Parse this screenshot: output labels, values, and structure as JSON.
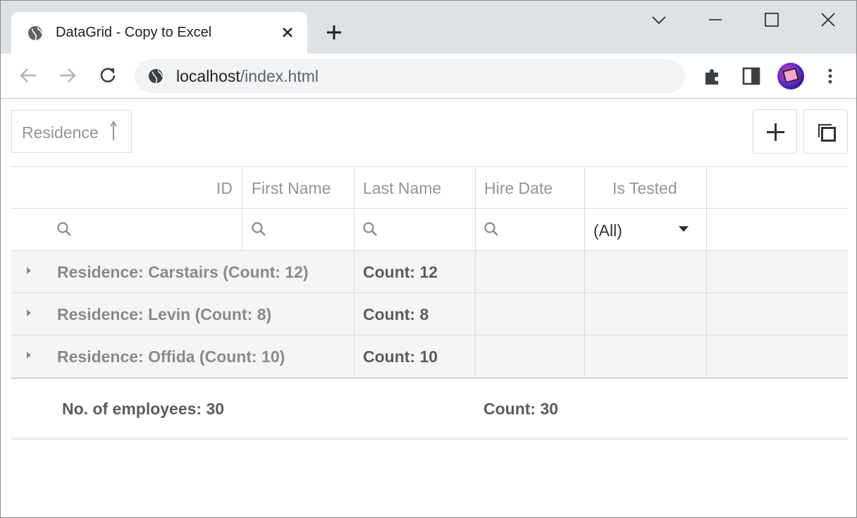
{
  "browser": {
    "tab_title": "DataGrid - Copy to Excel",
    "url_host": "localhost",
    "url_path": "/index.html",
    "icons": {
      "tab_favicon": "globe-icon",
      "tab_close": "close-icon",
      "new_tab": "plus-icon",
      "tab_search": "chevron-down-icon",
      "minimize": "minimize-icon",
      "maximize": "maximize-icon",
      "close_window": "close-icon",
      "back": "arrow-left-icon",
      "forward": "arrow-right-icon",
      "reload": "reload-icon",
      "site_info": "globe-icon",
      "extensions": "puzzle-icon",
      "side_panel": "side-panel-icon",
      "profile": "avatar",
      "menu": "more-vertical-icon"
    }
  },
  "datagrid": {
    "group_panel": {
      "chip_label": "Residence",
      "sort_direction": "ascending",
      "sort_icon": "arrow-up-icon"
    },
    "toolbar": {
      "add_icon": "plus-icon",
      "column_chooser_icon": "copy-icon"
    },
    "columns": [
      {
        "key": "id",
        "label": "ID",
        "align": "right"
      },
      {
        "key": "first_name",
        "label": "First Name",
        "align": "left"
      },
      {
        "key": "last_name",
        "label": "Last Name",
        "align": "left"
      },
      {
        "key": "hire_date",
        "label": "Hire Date",
        "align": "left"
      },
      {
        "key": "is_tested",
        "label": "Is Tested",
        "align": "center"
      }
    ],
    "filter_row": {
      "search_icon": "search-icon",
      "is_tested_value": "(All)"
    },
    "groups": [
      {
        "label": "Residence: Carstairs (Count: 12)",
        "count_label": "Count: 12",
        "expanded": false
      },
      {
        "label": "Residence: Levin (Count: 8)",
        "count_label": "Count: 8",
        "expanded": false
      },
      {
        "label": "Residence: Offida (Count: 10)",
        "count_label": "Count: 10",
        "expanded": false
      }
    ],
    "summary": {
      "total_label": "No. of employees: 30",
      "count_label": "Count: 30"
    }
  },
  "colors": {
    "tabstrip": "#dee1e6",
    "omnibox": "#f1f3f4",
    "grid_border": "#dddddd",
    "group_row_bg": "#f5f5f5",
    "header_text": "#959595",
    "group_text": "#8a8a8a",
    "summary_text": "#5c5c5c"
  }
}
